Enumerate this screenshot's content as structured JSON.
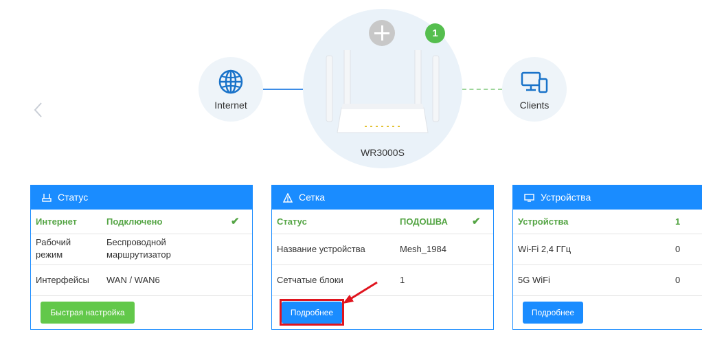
{
  "topology": {
    "internet_label": "Internet",
    "router_label": "WR3000S",
    "clients_label": "Clients",
    "node_count": "1",
    "icons": [
      "globe-icon",
      "router-image",
      "devices-icon",
      "plus-icon",
      "chevron-left-icon"
    ]
  },
  "status_card": {
    "title": "Статус",
    "rows": [
      {
        "label": "Интернет",
        "value": "Подключено"
      },
      {
        "label": "Рабочий режим",
        "value": "Беспроводной маршрутизатор"
      },
      {
        "label": "Интерфейсы",
        "value": "WAN / WAN6"
      }
    ],
    "button": "Быстрая настройка"
  },
  "mesh_card": {
    "title": "Сетка",
    "rows": [
      {
        "label": "Статус",
        "value": "ПОДОШВА"
      },
      {
        "label": "Название устройства",
        "value": "Mesh_1984"
      },
      {
        "label": "Сетчатые блоки",
        "value": "1"
      }
    ],
    "button": "Подробнее"
  },
  "devices_card": {
    "title": "Устройства",
    "rows": [
      {
        "label": "Устройства",
        "value": "1"
      },
      {
        "label": "Wi-Fi 2,4 ГГц",
        "value": "0"
      },
      {
        "label": "5G WiFi",
        "value": "0"
      }
    ],
    "button": "Подробнее"
  },
  "colors": {
    "primary": "#1a8cff",
    "success": "#55a545",
    "quick_setup": "#62c84a",
    "highlight": "#e0141e",
    "node_bg": "#eaf2f9"
  }
}
